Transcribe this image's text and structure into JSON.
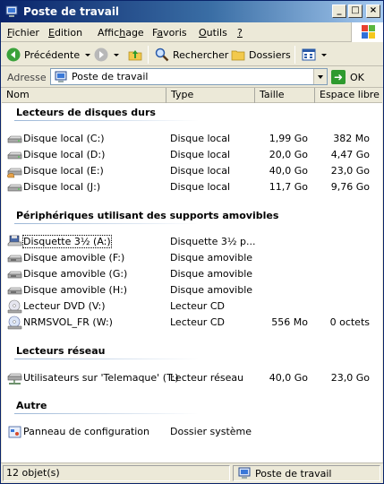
{
  "window": {
    "title": "Poste de travail"
  },
  "menu": {
    "items": [
      {
        "label": "Fichier",
        "u": "F",
        "rest": "ichier"
      },
      {
        "label": "Edition",
        "u": "E",
        "rest": "dition"
      },
      {
        "label": "Affichage",
        "pre": "Affic",
        "u": "h",
        "rest": "age"
      },
      {
        "label": "Favoris",
        "pre": "F",
        "u": "a",
        "rest": "voris"
      },
      {
        "label": "Outils",
        "u": "O",
        "rest": "utils"
      },
      {
        "label": "?",
        "u": "?",
        "rest": ""
      }
    ]
  },
  "toolbar": {
    "back_label": "Précédente",
    "search_label": "Rechercher",
    "folders_label": "Dossiers"
  },
  "address": {
    "label": "Adresse",
    "value": "Poste de travail",
    "go_label": "OK"
  },
  "columns": {
    "name": "Nom",
    "type": "Type",
    "total": "Taille totale",
    "free": "Espace libre"
  },
  "groups": [
    {
      "title": "Lecteurs de disques durs",
      "items": [
        {
          "name": "Disque local (C:)",
          "type": "Disque local",
          "total": "1,99 Go",
          "free": "382 Mo",
          "icon": "hard-drive-icon"
        },
        {
          "name": "Disque local (D:)",
          "type": "Disque local",
          "total": "20,0 Go",
          "free": "4,47 Go",
          "icon": "hard-drive-icon"
        },
        {
          "name": "Disque local (E:)",
          "type": "Disque local",
          "total": "40,0 Go",
          "free": "23,0 Go",
          "icon": "shared-drive-icon"
        },
        {
          "name": "Disque local (J:)",
          "type": "Disque local",
          "total": "11,7 Go",
          "free": "9,76 Go",
          "icon": "hard-drive-icon"
        }
      ]
    },
    {
      "title": "Périphériques utilisant des supports amovibles",
      "items": [
        {
          "name": "Disquette 3½ (A:)",
          "type": "Disquette 3½ p...",
          "total": "",
          "free": "",
          "icon": "floppy-drive-icon",
          "selected": true
        },
        {
          "name": "Disque amovible (F:)",
          "type": "Disque amovible",
          "total": "",
          "free": "",
          "icon": "removable-drive-icon"
        },
        {
          "name": "Disque amovible (G:)",
          "type": "Disque amovible",
          "total": "",
          "free": "",
          "icon": "removable-drive-icon"
        },
        {
          "name": "Disque amovible (H:)",
          "type": "Disque amovible",
          "total": "",
          "free": "",
          "icon": "removable-drive-icon"
        },
        {
          "name": "Lecteur DVD (V:)",
          "type": "Lecteur CD",
          "total": "",
          "free": "",
          "icon": "dvd-drive-icon"
        },
        {
          "name": "NRMSVOL_FR (W:)",
          "type": "Lecteur CD",
          "total": "556 Mo",
          "free": "0 octets",
          "icon": "cd-drive-icon"
        }
      ]
    },
    {
      "title": "Lecteurs réseau",
      "items": [
        {
          "name": "Utilisateurs sur 'Telemaque' (T:)",
          "type": "Lecteur réseau",
          "total": "40,0 Go",
          "free": "23,0 Go",
          "icon": "network-drive-icon"
        }
      ]
    },
    {
      "title": "Autre",
      "items": [
        {
          "name": "Panneau de configuration",
          "type": "Dossier système",
          "total": "",
          "free": "",
          "icon": "control-panel-icon"
        }
      ]
    }
  ],
  "status": {
    "count": "12 objet(s)",
    "location": "Poste de travail"
  },
  "colors": {
    "title_start": "#0a246a",
    "title_end": "#a6caf0",
    "face": "#ece9d8"
  }
}
